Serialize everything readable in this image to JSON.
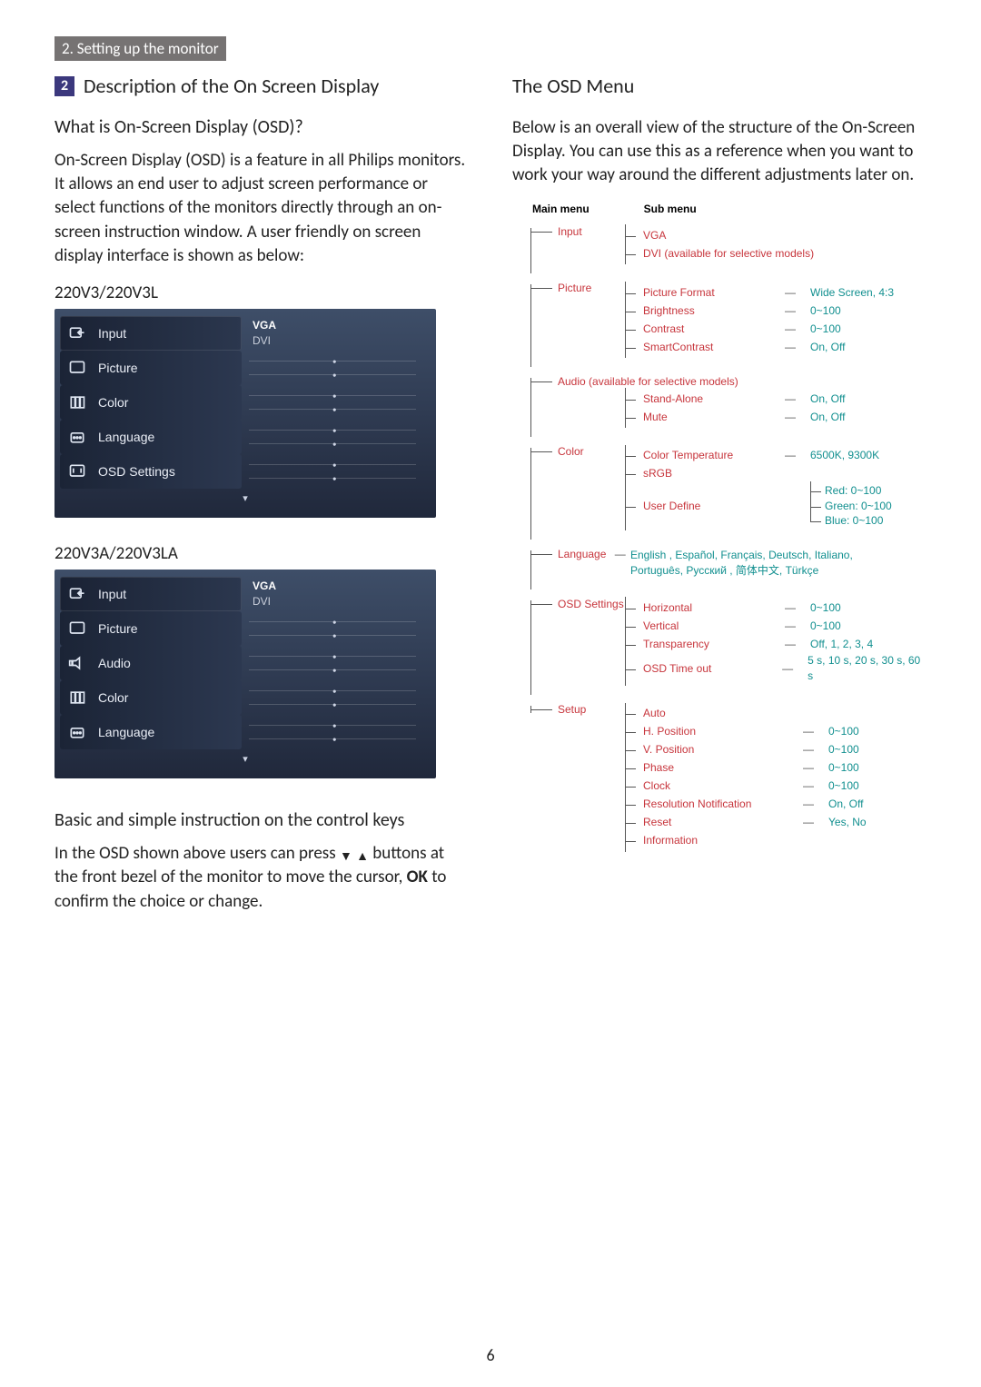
{
  "header": {
    "breadcrumb": "2. Setting up the monitor"
  },
  "section": {
    "num": "2",
    "title": "Description of the On Screen Display",
    "q_title": "What is On-Screen Display (OSD)?",
    "q_para": "On-Screen Display (OSD) is a feature in all Philips monitors. It allows an end user to adjust screen performance or select functions of the monitors directly through an on-screen instruction window. A user friendly on screen display interface is shown as below:",
    "model_a": "220V3/220V3L",
    "model_b": "220V3A/220V3LA",
    "basic_title": "Basic and simple instruction on the control keys",
    "basic_para_pre": "In the OSD shown above users can press ",
    "basic_para_mid": " buttons at the front bezel of the monitor to move the cursor, ",
    "basic_para_ok": "OK",
    "basic_para_post": " to confirm the choice or change."
  },
  "right": {
    "title": "The OSD Menu",
    "para": "Below is an overall view of the structure of the On-Screen Display. You can use this as a reference when you want to work your way around the different adjustments later on.",
    "head_main": "Main menu",
    "head_sub": "Sub menu"
  },
  "osd_a": {
    "items": [
      {
        "label": "Input",
        "icon": "input",
        "opts": [
          "VGA",
          "DVI"
        ]
      },
      {
        "label": "Picture",
        "icon": "picture"
      },
      {
        "label": "Color",
        "icon": "color"
      },
      {
        "label": "Language",
        "icon": "language"
      },
      {
        "label": "OSD Settings",
        "icon": "osd"
      }
    ]
  },
  "osd_b": {
    "items": [
      {
        "label": "Input",
        "icon": "input",
        "opts": [
          "VGA",
          "DVI"
        ]
      },
      {
        "label": "Picture",
        "icon": "picture"
      },
      {
        "label": "Audio",
        "icon": "audio"
      },
      {
        "label": "Color",
        "icon": "color"
      },
      {
        "label": "Language",
        "icon": "language"
      }
    ]
  },
  "tree": {
    "input": {
      "label": "Input",
      "subs": [
        "VGA",
        "DVI (available for selective models)"
      ]
    },
    "picture": {
      "label": "Picture",
      "rows": [
        {
          "k": "Picture Format",
          "v": "Wide Screen, 4:3"
        },
        {
          "k": "Brightness",
          "v": "0~100"
        },
        {
          "k": "Contrast",
          "v": "0~100"
        },
        {
          "k": "SmartContrast",
          "v": "On, Off"
        }
      ]
    },
    "audio": {
      "label": "Audio  (available for selective models)",
      "rows": [
        {
          "k": "Stand-Alone",
          "v": "On, Off"
        },
        {
          "k": "Mute",
          "v": "On, Off"
        }
      ]
    },
    "color": {
      "label": "Color",
      "row_ct": {
        "k": "Color Temperature",
        "v": "6500K, 9300K"
      },
      "row_srgb": "sRGB",
      "row_ud": "User Define",
      "ud_vals": [
        "Red: 0~100",
        "Green: 0~100",
        "Blue: 0~100"
      ]
    },
    "language": {
      "label": "Language",
      "text1": "English , Español, Français, Deutsch, Italiano,",
      "text2": "Português, Русский , 简体中文, Türkçe"
    },
    "osd": {
      "label": "OSD Settings",
      "rows": [
        {
          "k": "Horizontal",
          "v": "0~100"
        },
        {
          "k": "Vertical",
          "v": "0~100"
        },
        {
          "k": "Transparency",
          "v": "Off, 1, 2, 3, 4"
        },
        {
          "k": "OSD Time out",
          "v": "5 s, 10 s, 20 s, 30 s, 60 s"
        }
      ]
    },
    "setup": {
      "label": "Setup",
      "row_auto": "Auto",
      "rows": [
        {
          "k": "H. Position",
          "v": "0~100"
        },
        {
          "k": "V. Position",
          "v": "0~100"
        },
        {
          "k": "Phase",
          "v": "0~100"
        },
        {
          "k": "Clock",
          "v": "0~100"
        },
        {
          "k": "Resolution Notification",
          "v": "On, Off"
        },
        {
          "k": "Reset",
          "v": "Yes, No"
        }
      ],
      "row_info": "Information"
    }
  },
  "page_num": "6"
}
